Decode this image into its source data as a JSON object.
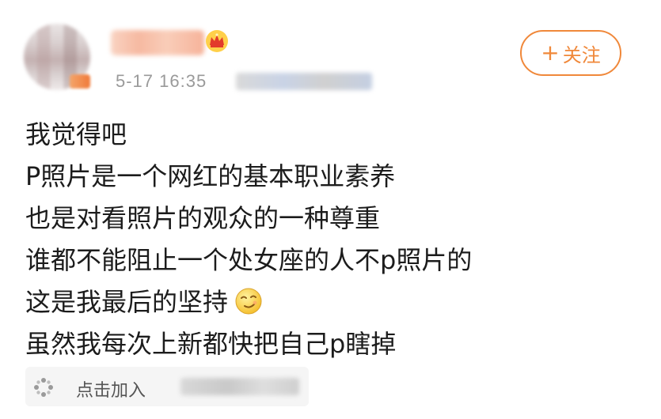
{
  "post": {
    "timestamp": "5-17 16:35",
    "follow_label": "关注",
    "follow_plus": "+",
    "lines": [
      "我觉得吧",
      "P照片是一个网红的基本职业素养",
      "也是对看照片的观众的一种尊重",
      "谁都不能阻止一个处女座的人不p照片的",
      "这是我最后的坚持",
      "虽然我每次上新都快把自己p瞎掉"
    ],
    "emoji": "smug-face-emoji",
    "supertopic_label": "点击加入"
  },
  "icons": {
    "crown": "crown-icon",
    "topic": "supertopic-icon"
  },
  "colors": {
    "accent": "#f0883a",
    "text": "#1c1c1c",
    "muted": "#9a9a9a"
  }
}
